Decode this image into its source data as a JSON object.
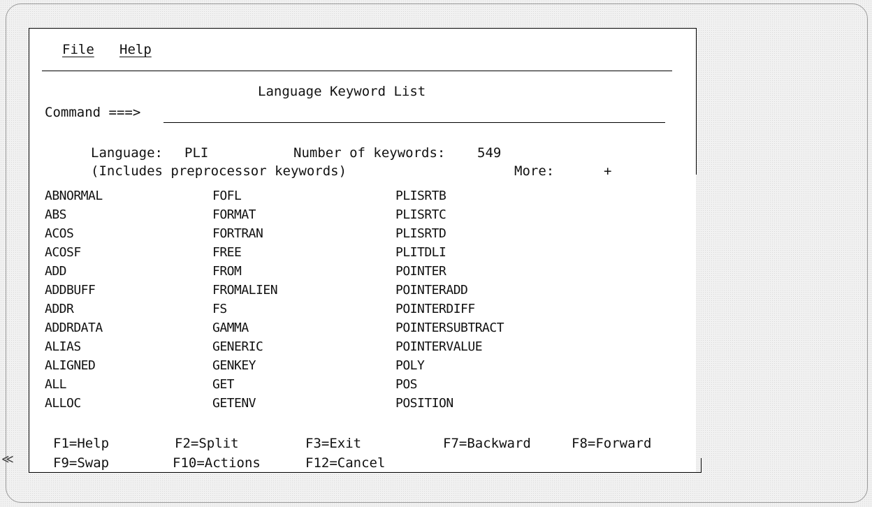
{
  "menu": {
    "file": "File",
    "help": "Help"
  },
  "panel": {
    "title": "Language Keyword List",
    "command_label": "Command ===>",
    "command_value": "",
    "language_label": "Language:",
    "language_value": "PLI",
    "count_label": "Number of keywords:",
    "count_value": "549",
    "includes_note": "(Includes preprocessor keywords)",
    "more_label": "More:",
    "more_indicator": "+"
  },
  "keywords": {
    "col1": [
      "ABNORMAL",
      "ABS",
      "ACOS",
      "ACOSF",
      "ADD",
      "ADDBUFF",
      "ADDR",
      "ADDRDATA",
      "ALIAS",
      "ALIGNED",
      "ALL",
      "ALLOC"
    ],
    "col2": [
      "FOFL",
      "FORMAT",
      "FORTRAN",
      "FREE",
      "FROM",
      "FROMALIEN",
      "FS",
      "GAMMA",
      "GENERIC",
      "GENKEY",
      "GET",
      "GETENV"
    ],
    "col3": [
      "PLISRTB",
      "PLISRTC",
      "PLISRTD",
      "PLITDLI",
      "POINTER",
      "POINTERADD",
      "POINTERDIFF",
      "POINTERSUBTRACT",
      "POINTERVALUE",
      "POLY",
      "POS",
      "POSITION"
    ]
  },
  "function_keys": {
    "f1": "F1=Help",
    "f2": "F2=Split",
    "f3": "F3=Exit",
    "f7": "F7=Backward",
    "f8": "F8=Forward",
    "f9": "F9=Swap",
    "f10": "F10=Actions",
    "f12": "F12=Cancel"
  },
  "scroll_marker": "≪"
}
